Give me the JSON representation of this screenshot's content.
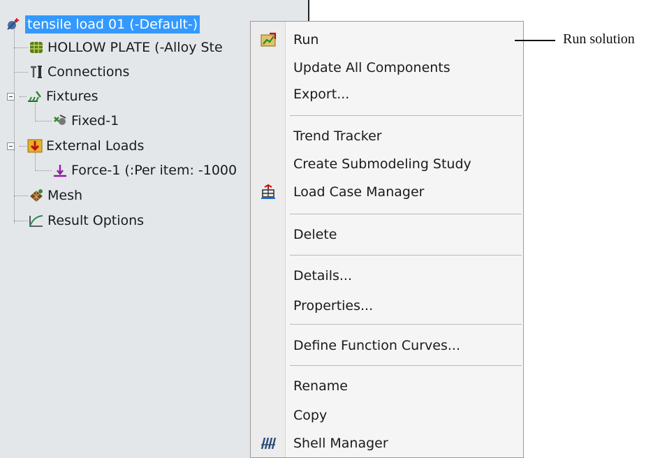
{
  "tree": {
    "root_label": "tensile load 01 (-Default-)",
    "items": [
      {
        "label": "HOLLOW PLATE (-Alloy Ste"
      },
      {
        "label": "Connections"
      },
      {
        "label": "Fixtures"
      },
      {
        "label": "Fixed-1"
      },
      {
        "label": "External Loads"
      },
      {
        "label": "Force-1 (:Per item: -1000"
      },
      {
        "label": "Mesh"
      },
      {
        "label": "Result Options"
      }
    ]
  },
  "context_menu": {
    "items": [
      {
        "label": "Run",
        "icon": "run-icon"
      },
      {
        "label": "Update All Components"
      },
      {
        "label": "Export..."
      },
      {
        "label": "Trend Tracker"
      },
      {
        "label": "Create Submodeling Study"
      },
      {
        "label": "Load Case Manager",
        "icon": "load-case-manager-icon"
      },
      {
        "label": "Delete"
      },
      {
        "label": "Details..."
      },
      {
        "label": "Properties..."
      },
      {
        "label": "Define Function Curves..."
      },
      {
        "label": "Rename"
      },
      {
        "label": "Copy"
      },
      {
        "label": "Shell Manager",
        "icon": "shell-manager-icon"
      }
    ]
  },
  "annotation": {
    "text": "Run solution"
  },
  "colors": {
    "selection": "#3399ff",
    "panel_bg": "#e4e7ea",
    "menu_bg": "#f5f5f5"
  }
}
